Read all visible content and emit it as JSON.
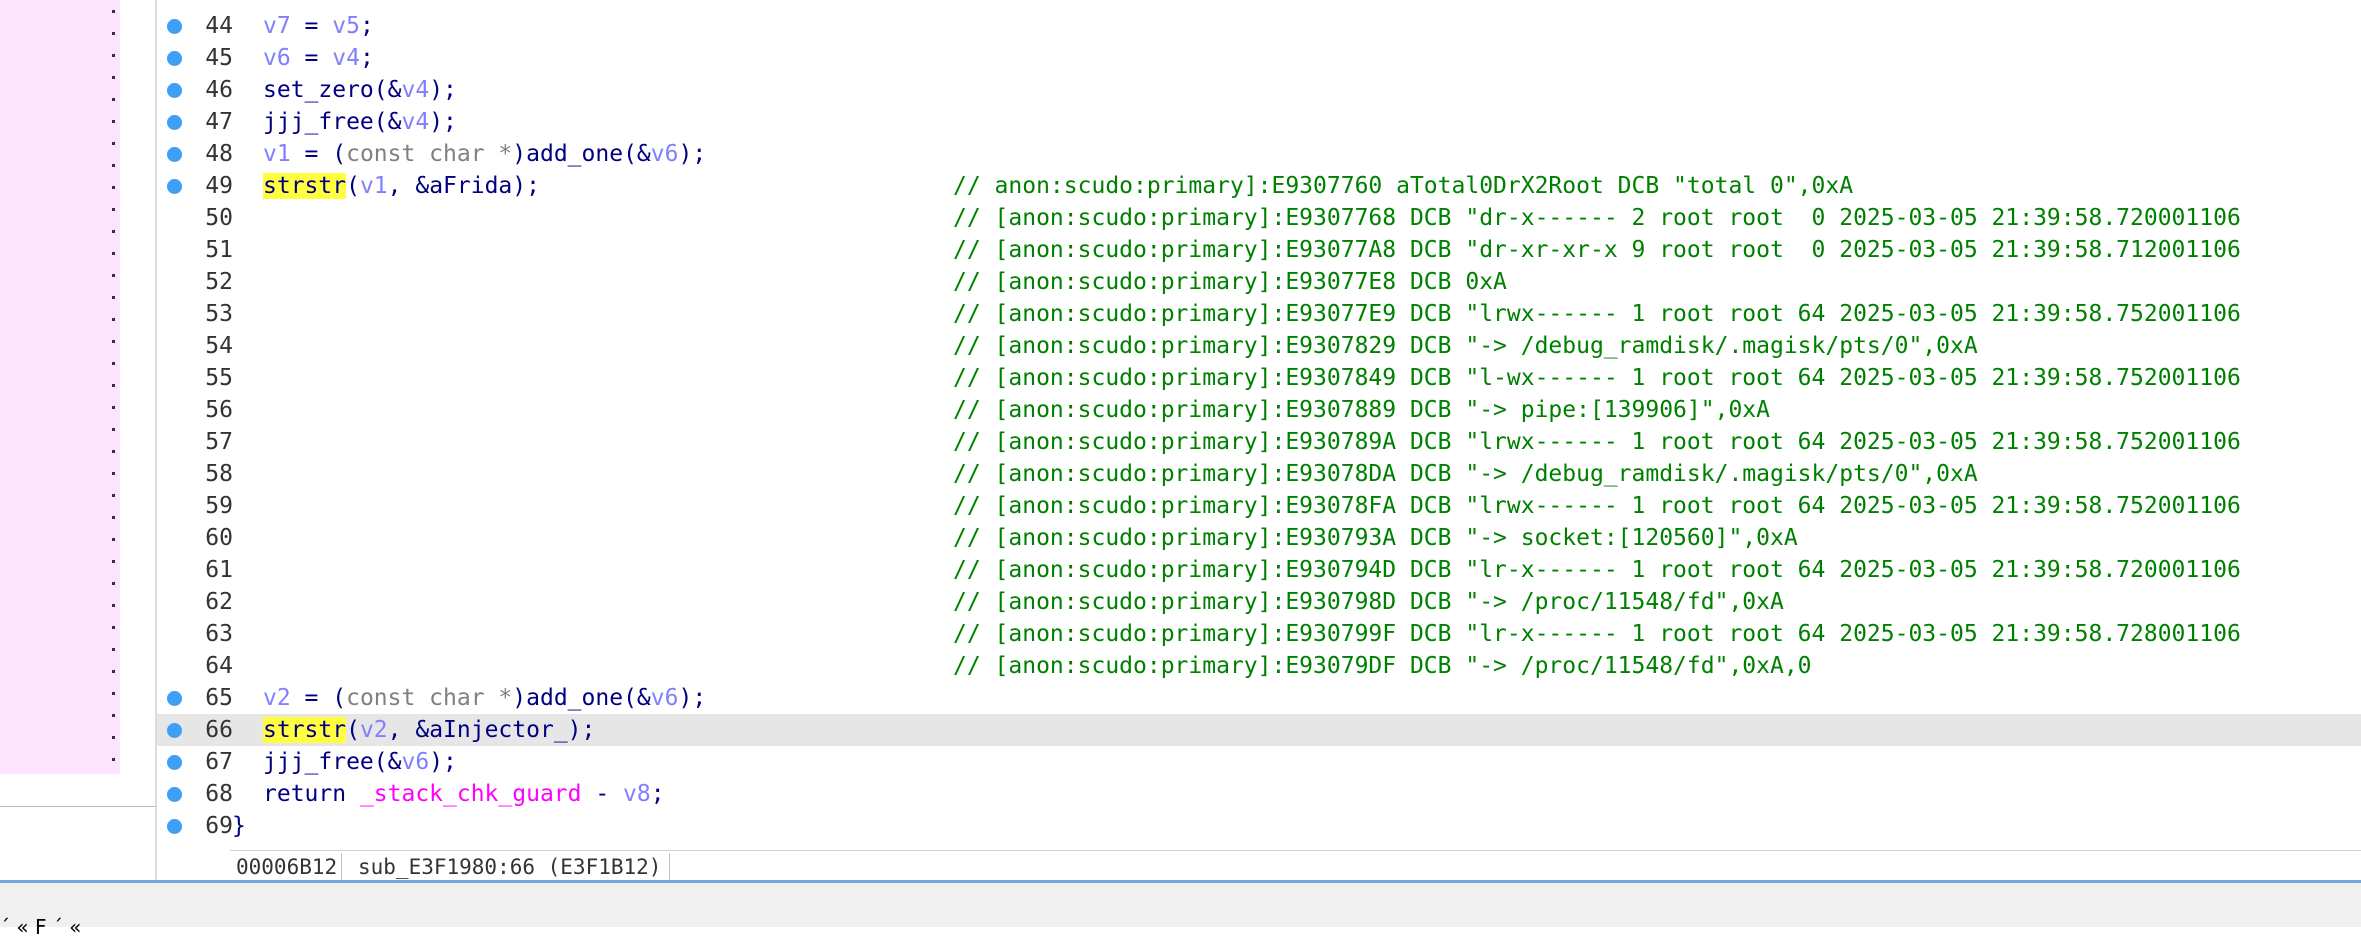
{
  "editor": {
    "lines": [
      {
        "num": "44",
        "bp": true,
        "code": [
          [
            "var",
            "v7"
          ],
          [
            "plain",
            " = "
          ],
          [
            "var",
            "v5"
          ],
          [
            "plain",
            ";"
          ]
        ],
        "comment": ""
      },
      {
        "num": "45",
        "bp": true,
        "code": [
          [
            "var",
            "v6"
          ],
          [
            "plain",
            " = "
          ],
          [
            "var",
            "v4"
          ],
          [
            "plain",
            ";"
          ]
        ],
        "comment": ""
      },
      {
        "num": "46",
        "bp": true,
        "code": [
          [
            "fn",
            "set_zero"
          ],
          [
            "plain",
            "(&"
          ],
          [
            "var",
            "v4"
          ],
          [
            "plain",
            ");"
          ]
        ],
        "comment": ""
      },
      {
        "num": "47",
        "bp": true,
        "code": [
          [
            "fn",
            "jjj_free"
          ],
          [
            "plain",
            "(&"
          ],
          [
            "var",
            "v4"
          ],
          [
            "plain",
            ");"
          ]
        ],
        "comment": ""
      },
      {
        "num": "48",
        "bp": true,
        "code": [
          [
            "var",
            "v1"
          ],
          [
            "plain",
            " = ("
          ],
          [
            "kw",
            "const char *"
          ],
          [
            "plain",
            ")"
          ],
          [
            "fn",
            "add_one"
          ],
          [
            "plain",
            "(&"
          ],
          [
            "var",
            "v6"
          ],
          [
            "plain",
            ");"
          ]
        ],
        "comment": ""
      },
      {
        "num": "49",
        "bp": true,
        "code": [
          [
            "hl",
            "strstr"
          ],
          [
            "plain",
            "("
          ],
          [
            "var",
            "v1"
          ],
          [
            "plain",
            ", &aFrida);"
          ]
        ],
        "comment": "// anon:scudo:primary]:E9307760 aTotal0DrX2Root DCB \"total 0\",0xA"
      },
      {
        "num": "50",
        "bp": false,
        "code": [],
        "comment": "// [anon:scudo:primary]:E9307768 DCB \"dr-x------ 2 root root  0 2025-03-05 21:39:58.720001106"
      },
      {
        "num": "51",
        "bp": false,
        "code": [],
        "comment": "// [anon:scudo:primary]:E93077A8 DCB \"dr-xr-xr-x 9 root root  0 2025-03-05 21:39:58.712001106"
      },
      {
        "num": "52",
        "bp": false,
        "code": [],
        "comment": "// [anon:scudo:primary]:E93077E8 DCB 0xA"
      },
      {
        "num": "53",
        "bp": false,
        "code": [],
        "comment": "// [anon:scudo:primary]:E93077E9 DCB \"lrwx------ 1 root root 64 2025-03-05 21:39:58.752001106"
      },
      {
        "num": "54",
        "bp": false,
        "code": [],
        "comment": "// [anon:scudo:primary]:E9307829 DCB \"-> /debug_ramdisk/.magisk/pts/0\",0xA"
      },
      {
        "num": "55",
        "bp": false,
        "code": [],
        "comment": "// [anon:scudo:primary]:E9307849 DCB \"l-wx------ 1 root root 64 2025-03-05 21:39:58.752001106"
      },
      {
        "num": "56",
        "bp": false,
        "code": [],
        "comment": "// [anon:scudo:primary]:E9307889 DCB \"-> pipe:[139906]\",0xA"
      },
      {
        "num": "57",
        "bp": false,
        "code": [],
        "comment": "// [anon:scudo:primary]:E930789A DCB \"lrwx------ 1 root root 64 2025-03-05 21:39:58.752001106"
      },
      {
        "num": "58",
        "bp": false,
        "code": [],
        "comment": "// [anon:scudo:primary]:E93078DA DCB \"-> /debug_ramdisk/.magisk/pts/0\",0xA"
      },
      {
        "num": "59",
        "bp": false,
        "code": [],
        "comment": "// [anon:scudo:primary]:E93078FA DCB \"lrwx------ 1 root root 64 2025-03-05 21:39:58.752001106"
      },
      {
        "num": "60",
        "bp": false,
        "code": [],
        "comment": "// [anon:scudo:primary]:E930793A DCB \"-> socket:[120560]\",0xA"
      },
      {
        "num": "61",
        "bp": false,
        "code": [],
        "comment": "// [anon:scudo:primary]:E930794D DCB \"lr-x------ 1 root root 64 2025-03-05 21:39:58.720001106"
      },
      {
        "num": "62",
        "bp": false,
        "code": [],
        "comment": "// [anon:scudo:primary]:E930798D DCB \"-> /proc/11548/fd\",0xA"
      },
      {
        "num": "63",
        "bp": false,
        "code": [],
        "comment": "// [anon:scudo:primary]:E930799F DCB \"lr-x------ 1 root root 64 2025-03-05 21:39:58.728001106"
      },
      {
        "num": "64",
        "bp": false,
        "code": [],
        "comment": "// [anon:scudo:primary]:E93079DF DCB \"-> /proc/11548/fd\",0xA,0"
      },
      {
        "num": "65",
        "bp": true,
        "code": [
          [
            "var",
            "v2"
          ],
          [
            "plain",
            " = ("
          ],
          [
            "kw",
            "const char *"
          ],
          [
            "plain",
            ")"
          ],
          [
            "fn",
            "add_one"
          ],
          [
            "plain",
            "(&"
          ],
          [
            "var",
            "v6"
          ],
          [
            "plain",
            ");"
          ]
        ],
        "comment": ""
      },
      {
        "num": "66",
        "bp": true,
        "current": true,
        "code": [
          [
            "hl",
            "strstr"
          ],
          [
            "plain",
            "("
          ],
          [
            "var",
            "v2"
          ],
          [
            "plain",
            ", &aInjector_);"
          ]
        ],
        "comment": ""
      },
      {
        "num": "67",
        "bp": true,
        "code": [
          [
            "fn",
            "jjj_free"
          ],
          [
            "plain",
            "(&"
          ],
          [
            "var",
            "v6"
          ],
          [
            "plain",
            ");"
          ]
        ],
        "comment": ""
      },
      {
        "num": "68",
        "bp": true,
        "code": [
          [
            "plain",
            "return "
          ],
          [
            "glob",
            "_stack_chk_guard"
          ],
          [
            "plain",
            " - "
          ],
          [
            "var",
            "v8"
          ],
          [
            "plain",
            ";"
          ]
        ],
        "comment": ""
      },
      {
        "num": "69",
        "bp": true,
        "brace": "}",
        "code": [],
        "comment": ""
      }
    ]
  },
  "status": {
    "address": "00006B12",
    "location": "sub_E3F1980:66 (E3F1B12)"
  },
  "bottom": {
    "glyphs": "´ «  F  ´ «"
  },
  "colors": {
    "breakpoint": "#3da0f5",
    "comment": "#008000",
    "highlight": "#ffff40",
    "left_panel": "#fce4fc"
  }
}
